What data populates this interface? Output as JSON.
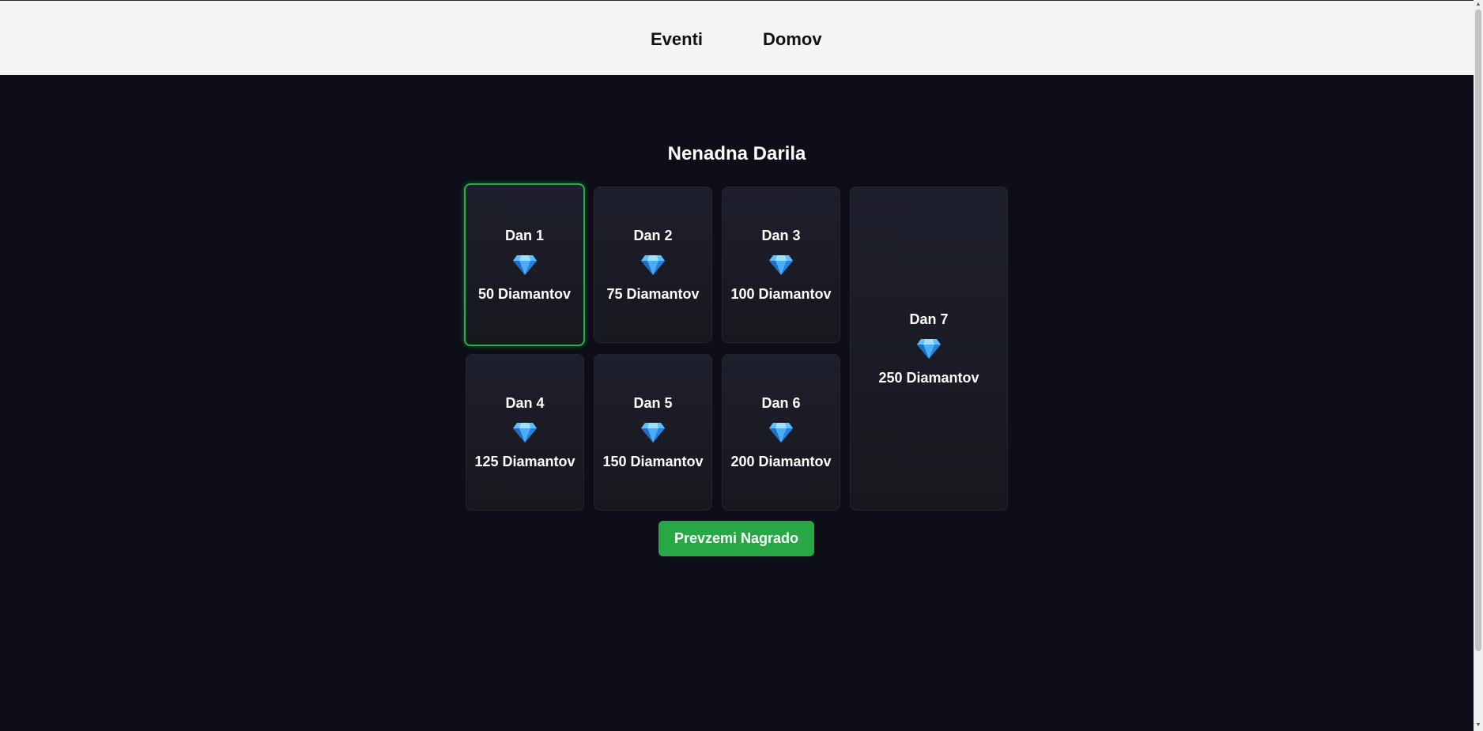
{
  "nav": {
    "items": [
      {
        "label": "Eventi"
      },
      {
        "label": "Domov"
      }
    ]
  },
  "page": {
    "title": "Nenadna Darila"
  },
  "rewards": [
    {
      "day": "Dan 1",
      "amount": "50 Diamantov",
      "active": true
    },
    {
      "day": "Dan 2",
      "amount": "75 Diamantov",
      "active": false
    },
    {
      "day": "Dan 3",
      "amount": "100 Diamantov",
      "active": false
    },
    {
      "day": "Dan 4",
      "amount": "125 Diamantov",
      "active": false
    },
    {
      "day": "Dan 5",
      "amount": "150 Diamantov",
      "active": false
    },
    {
      "day": "Dan 6",
      "amount": "200 Diamantov",
      "active": false
    },
    {
      "day": "Dan 7",
      "amount": "250 Diamantov",
      "active": false
    }
  ],
  "reward_icon": "diamond-icon",
  "claim": {
    "label": "Prevzemi Nagrado"
  },
  "colors": {
    "background": "#0d0e17",
    "nav_background": "#f4f4f4",
    "accent_green": "#28a745",
    "active_border": "#22b24a",
    "gem_blue": "#3aa0f0"
  }
}
